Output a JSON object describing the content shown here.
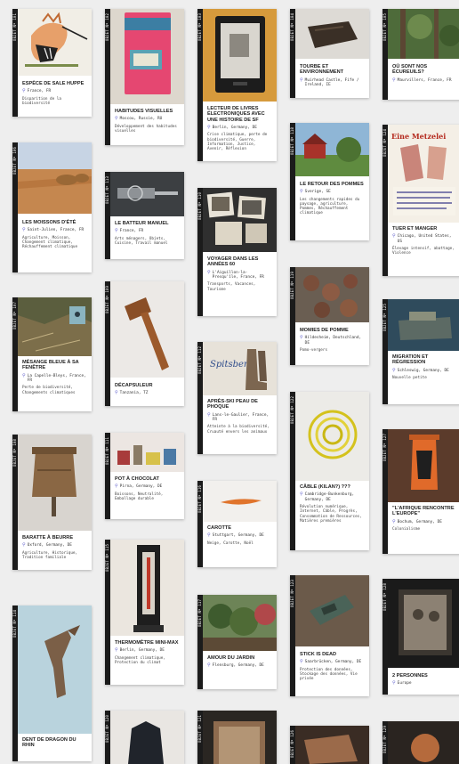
{
  "pin_icon": "location-pin-icon",
  "cards": {
    "c1": {
      "title": "Espèce de sale huppe",
      "location": "France, FR",
      "tags": "Disparition de la biodiversité"
    },
    "c2": {
      "title": "Habitudes visuelles",
      "location": "Moscou, Russie, RU",
      "tags": "Développement des habitudes visuelles"
    },
    "c3": {
      "title": "Lecteur de livres électroniques avec une histoire de SF",
      "location": "Berlin, Germany, DE",
      "tags": "Crise climatique, perte de biodiversité, Guerre, Information, Justice, Avenir, Réflexion"
    },
    "c4": {
      "title": "Tourbe et environnement",
      "location": "Muirhead Castle, Fife / Ireland, IE",
      "tags": ""
    },
    "c5": {
      "title": "Où sont nos écureuils?",
      "location": "Maurvillers, France, FR",
      "tags": ""
    },
    "c6": {
      "title": "Les moissons d'été",
      "location": "Saint-Julien, France, FR",
      "tags": "Agriculture, Moisson, Changement climatique, Réchauffement climatique"
    },
    "c7": {
      "title": "Le batteur manuel",
      "location": "France, FR",
      "tags": "Arts ménagers, Objets, Cuisine, Travail manuel"
    },
    "c8": {
      "title": "Le retour des pommes",
      "location": "Sverige, SE",
      "tags": "Les changements rapides du paysage, agriculture, Pommes, Réchauffement climatique"
    },
    "c9": {
      "title": "Tuer et manger",
      "location": "Chicago, United States, US",
      "tags": "Élevage intensif, abattage, Violence"
    },
    "c10": {
      "title": "Voyager dans les années 60",
      "location": "L'Aiguillon-la-Presqu'île, France, FR",
      "tags": "Transports, Vacances, Tourisme"
    },
    "c11": {
      "title": "Momies de pomme",
      "location": "Hildesheim, Deutschland, DE",
      "tags": "Pomo-vergers"
    },
    "c12": {
      "title": "Mésange bleue à sa fenêtre",
      "location": "La Capelle-Bleys, France, FR",
      "tags": "Perte de biodiversité, Changements climatiques"
    },
    "c13": {
      "title": "Décapsuleur",
      "location": "Tanzania, TZ",
      "tags": ""
    },
    "c14": {
      "title": "Après-ski peau de phoque",
      "location": "Lans-le-Gaulier, France, FR",
      "tags": "Atteinte à la biodiversité, Cruauté envers les animaux"
    },
    "c15": {
      "title": "Migration et régression",
      "location": "Schleswig, Germany, DE",
      "tags": "Nouvelle petite"
    },
    "c16": {
      "title": "Baratte à beurre",
      "location": "Oxford, Germany, DE",
      "tags": "Agriculture, Historique, Tradition familiale"
    },
    "c17": {
      "title": "Pot à chocolat",
      "location": "Pirna, Germany, DE",
      "tags": "Boissons, Neutralité, Emballage durable"
    },
    "c18": {
      "title": "Câble (Kilan?) ???",
      "location": "Cambridge-Bunkenburg, Germany, DE",
      "tags": "Révolution numérique, Internet, Câble, Progrès, Consommation de Ressources, Matières premières"
    },
    "c19": {
      "title": "\"L'Afrique rencontre l'Europe\"",
      "location": "Bochum, Germany, DE",
      "tags": "Colonialisme"
    },
    "c20": {
      "title": "Carotte",
      "location": "Stuttgart, Germany, DE",
      "tags": "Neige, Carotte, Noël"
    },
    "c21": {
      "title": "Thermomètre mini-max",
      "location": "Berlin, Germany, DE",
      "tags": "Changement climatique, Protection du climat"
    },
    "c22": {
      "title": "Amour du jardin",
      "location": "Flensburg, Germany, DE",
      "tags": ""
    },
    "c23": {
      "title": "Stick is dead",
      "location": "Saarbrücken, Germany, DE",
      "tags": "Protection des données, Stockage des données, Vie privée"
    },
    "c24": {
      "title": "2 personnes",
      "location": "Europe",
      "tags": ""
    },
    "c25": {
      "title": "Dent de dragon du Rhin",
      "location": "",
      "tags": ""
    }
  }
}
